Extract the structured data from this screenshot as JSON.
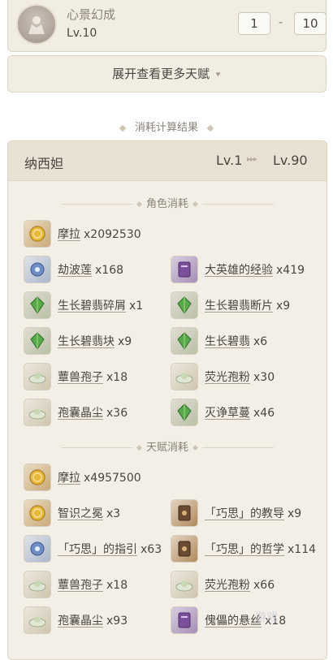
{
  "talent": {
    "name": "心景幻成",
    "level": "Lv.10",
    "level_from": "1",
    "level_to": "10",
    "icon": "talent-emblem-icon"
  },
  "expand_button": {
    "label": "展开查看更多天赋",
    "icon": "double-chevron-down-icon"
  },
  "result_title": "消耗计算结果",
  "character": {
    "name": "纳西妲",
    "level_from": "Lv.1",
    "level_arrows": "▸▸▸",
    "level_to": "Lv.90"
  },
  "character_costs": {
    "title": "角色消耗",
    "items": [
      {
        "name": "摩拉",
        "count": "x2092530",
        "icon": "mora-coin-icon",
        "tone": "gold"
      },
      {
        "name": "劫波莲",
        "count": "x168",
        "icon": "kalpalata-lotus-icon",
        "tone": "blue"
      },
      {
        "name": "大英雄的经验",
        "count": "x419",
        "icon": "heros-wit-book-icon",
        "tone": "purple"
      },
      {
        "name": "生长碧翡碎屑",
        "count": "x1",
        "icon": "nagadus-emerald-sliver-icon",
        "tone": "green"
      },
      {
        "name": "生长碧翡断片",
        "count": "x9",
        "icon": "nagadus-emerald-fragment-icon",
        "tone": "green"
      },
      {
        "name": "生长碧翡块",
        "count": "x9",
        "icon": "nagadus-emerald-chunk-icon",
        "tone": "green"
      },
      {
        "name": "生长碧翡",
        "count": "x6",
        "icon": "nagadus-emerald-gemstone-icon",
        "tone": "green"
      },
      {
        "name": "蕈兽孢子",
        "count": "x18",
        "icon": "fungal-spores-icon",
        "tone": "pale"
      },
      {
        "name": "荧光孢粉",
        "count": "x30",
        "icon": "luminescent-pollen-icon",
        "tone": "pale"
      },
      {
        "name": "孢囊晶尘",
        "count": "x36",
        "icon": "crystalline-cyst-dust-icon",
        "tone": "pale"
      },
      {
        "name": "灭诤草蔓",
        "count": "x46",
        "icon": "quelled-creeper-icon",
        "tone": "green"
      }
    ]
  },
  "talent_costs": {
    "title": "天赋消耗",
    "items": [
      {
        "name": "摩拉",
        "count": "x4957500",
        "icon": "mora-coin-icon",
        "tone": "gold"
      },
      {
        "name": "智识之冕",
        "count": "x3",
        "icon": "crown-of-insight-icon",
        "tone": "gold"
      },
      {
        "name": "「巧思」的教导",
        "count": "x9",
        "icon": "teachings-of-ingenuity-icon",
        "tone": "brown"
      },
      {
        "name": "「巧思」的指引",
        "count": "x63",
        "icon": "guide-to-ingenuity-icon",
        "tone": "blue"
      },
      {
        "name": "「巧思」的哲学",
        "count": "x114",
        "icon": "philosophies-of-ingenuity-icon",
        "tone": "brown"
      },
      {
        "name": "蕈兽孢子",
        "count": "x18",
        "icon": "fungal-spores-icon",
        "tone": "pale"
      },
      {
        "name": "荧光孢粉",
        "count": "x66",
        "icon": "luminescent-pollen-icon",
        "tone": "pale"
      },
      {
        "name": "孢囊晶尘",
        "count": "x93",
        "icon": "crystalline-cyst-dust-icon",
        "tone": "pale"
      },
      {
        "name": "傀儡的悬丝",
        "count": "x18",
        "icon": "puppet-strings-icon",
        "tone": "purple"
      }
    ]
  },
  "watermark": "游戏"
}
